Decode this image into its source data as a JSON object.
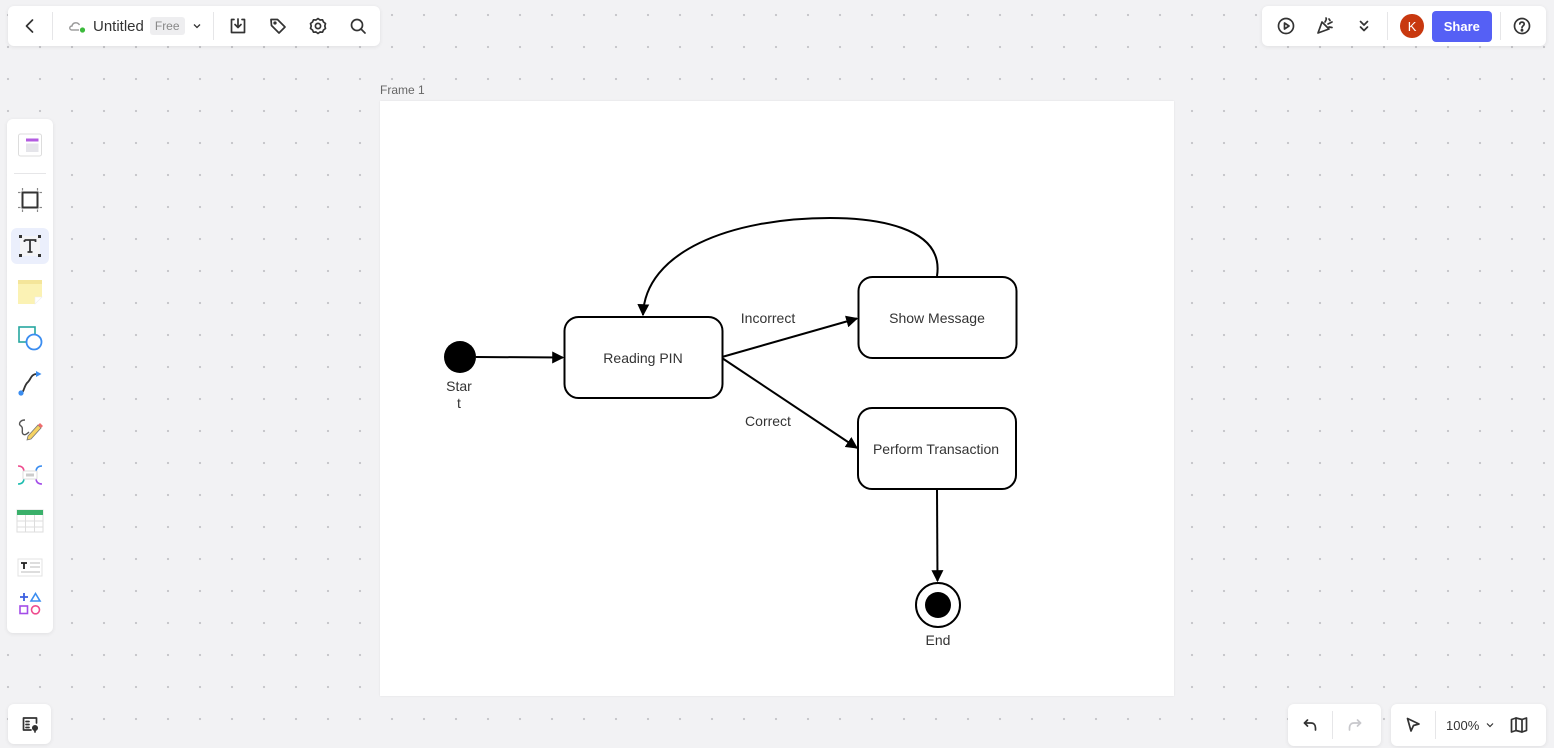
{
  "header": {
    "back_icon": "chevron-left-icon",
    "cloud_icon": "cloud-synced-icon",
    "doc_title": "Untitled",
    "plan_badge": "Free",
    "tools": [
      "download-icon",
      "tag-icon",
      "gear-icon",
      "search-icon"
    ]
  },
  "top_right": {
    "tools": [
      "play-icon",
      "celebrate-icon",
      "double-chevron-down-icon"
    ],
    "avatar_initial": "K",
    "share_label": "Share",
    "help_icon": "help-icon",
    "colors": {
      "share": "#5560f5",
      "avatar": "#c8380f"
    }
  },
  "left_toolbar": {
    "items": [
      {
        "name": "template",
        "active": false
      },
      {
        "name": "frame",
        "active": false
      },
      {
        "name": "text",
        "active": true
      },
      {
        "name": "sticky-note",
        "active": false
      },
      {
        "name": "shape",
        "active": false
      },
      {
        "name": "connector",
        "active": false
      },
      {
        "name": "pen",
        "active": false
      },
      {
        "name": "mindmap",
        "active": false
      },
      {
        "name": "table",
        "active": false
      },
      {
        "name": "text-block",
        "active": false
      },
      {
        "name": "more-tools",
        "active": false
      }
    ]
  },
  "bottom": {
    "zoom_level": "100%",
    "undo_enabled": true,
    "redo_enabled": false
  },
  "frame": {
    "label": "Frame 1"
  },
  "diagram": {
    "type": "state-machine",
    "nodes": [
      {
        "id": "start",
        "kind": "initial",
        "label": "Start",
        "label_lines": [
          "Star",
          "t"
        ]
      },
      {
        "id": "reading_pin",
        "kind": "state",
        "label": "Reading PIN"
      },
      {
        "id": "show_message",
        "kind": "state",
        "label": "Show Message"
      },
      {
        "id": "perform_transaction",
        "kind": "state",
        "label": "Perform Transaction"
      },
      {
        "id": "end",
        "kind": "final",
        "label": "End"
      }
    ],
    "edges": [
      {
        "from": "start",
        "to": "reading_pin",
        "label": ""
      },
      {
        "from": "reading_pin",
        "to": "show_message",
        "label": "Incorrect"
      },
      {
        "from": "reading_pin",
        "to": "perform_transaction",
        "label": "Correct"
      },
      {
        "from": "show_message",
        "to": "reading_pin",
        "label": ""
      },
      {
        "from": "perform_transaction",
        "to": "end",
        "label": ""
      }
    ]
  }
}
